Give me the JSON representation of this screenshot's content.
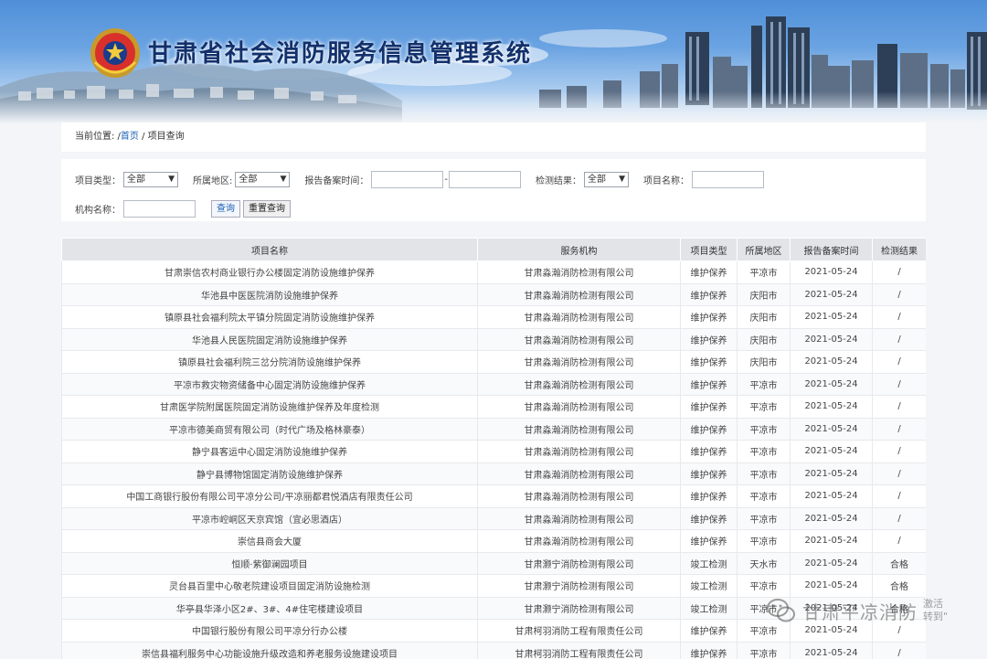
{
  "header": {
    "site_title": "甘肃省社会消防服务信息管理系统"
  },
  "breadcrumb": {
    "prefix": "当前位置: /",
    "home": "首页",
    "separator": " / ",
    "current": "项目查询"
  },
  "filters": {
    "project_type_label": "项目类型：",
    "project_type_value": "全部",
    "region_label": "所属地区:",
    "region_value": "全部",
    "report_time_label": "报告备案时间：",
    "date_separator": "-",
    "result_label": "检测结果：",
    "result_value": "全部",
    "project_name_label": "项目名称：",
    "org_name_label": "机构名称：",
    "search_button": "查询",
    "reset_button": "重置查询"
  },
  "table": {
    "columns": [
      "项目名称",
      "服务机构",
      "项目类型",
      "所属地区",
      "报告备案时间",
      "检测结果"
    ],
    "rows": [
      [
        "甘肃崇信农村商业银行办公楼固定消防设施维护保养",
        "甘肃淼瀚消防检测有限公司",
        "维护保养",
        "平凉市",
        "2021-05-24",
        "/"
      ],
      [
        "华池县中医医院消防设施维护保养",
        "甘肃淼瀚消防检测有限公司",
        "维护保养",
        "庆阳市",
        "2021-05-24",
        "/"
      ],
      [
        "镇原县社会福利院太平镇分院固定消防设施维护保养",
        "甘肃淼瀚消防检测有限公司",
        "维护保养",
        "庆阳市",
        "2021-05-24",
        "/"
      ],
      [
        "华池县人民医院固定消防设施维护保养",
        "甘肃淼瀚消防检测有限公司",
        "维护保养",
        "庆阳市",
        "2021-05-24",
        "/"
      ],
      [
        "镇原县社会福利院三岔分院消防设施维护保养",
        "甘肃淼瀚消防检测有限公司",
        "维护保养",
        "庆阳市",
        "2021-05-24",
        "/"
      ],
      [
        "平凉市救灾物资储备中心固定消防设施维护保养",
        "甘肃淼瀚消防检测有限公司",
        "维护保养",
        "平凉市",
        "2021-05-24",
        "/"
      ],
      [
        "甘肃医学院附属医院固定消防设施维护保养及年度检测",
        "甘肃淼瀚消防检测有限公司",
        "维护保养",
        "平凉市",
        "2021-05-24",
        "/"
      ],
      [
        "平凉市德美商贸有限公司（时代广场及格林豪泰）",
        "甘肃淼瀚消防检测有限公司",
        "维护保养",
        "平凉市",
        "2021-05-24",
        "/"
      ],
      [
        "静宁县客运中心固定消防设施维护保养",
        "甘肃淼瀚消防检测有限公司",
        "维护保养",
        "平凉市",
        "2021-05-24",
        "/"
      ],
      [
        "静宁县博物馆固定消防设施维护保养",
        "甘肃淼瀚消防检测有限公司",
        "维护保养",
        "平凉市",
        "2021-05-24",
        "/"
      ],
      [
        "中国工商银行股份有限公司平凉分公司/平凉丽都君悦酒店有限责任公司",
        "甘肃淼瀚消防检测有限公司",
        "维护保养",
        "平凉市",
        "2021-05-24",
        "/"
      ],
      [
        "平凉市崆峒区天京宾馆（宜必思酒店）",
        "甘肃淼瀚消防检测有限公司",
        "维护保养",
        "平凉市",
        "2021-05-24",
        "/"
      ],
      [
        "崇信县商会大厦",
        "甘肃淼瀚消防检测有限公司",
        "维护保养",
        "平凉市",
        "2021-05-24",
        "/"
      ],
      [
        "恒顺·紫御澜园项目",
        "甘肃灏宁消防检测有限公司",
        "竣工检测",
        "天水市",
        "2021-05-24",
        "合格"
      ],
      [
        "灵台县百里中心敬老院建设项目固定消防设施检测",
        "甘肃灏宁消防检测有限公司",
        "竣工检测",
        "平凉市",
        "2021-05-24",
        "合格"
      ],
      [
        "华亭县华泽小区2#、3#、4#住宅楼建设项目",
        "甘肃灏宁消防检测有限公司",
        "竣工检测",
        "平凉市",
        "2021-05-24",
        "合格"
      ],
      [
        "中国银行股份有限公司平凉分行办公楼",
        "甘肃柯羽消防工程有限责任公司",
        "维护保养",
        "平凉市",
        "2021-05-24",
        "/"
      ],
      [
        "崇信县福利服务中心功能设施升级改造和养老服务设施建设项目",
        "甘肃柯羽消防工程有限责任公司",
        "维护保养",
        "平凉市",
        "2021-05-24",
        "/"
      ]
    ]
  },
  "watermark": {
    "text": "甘肃平凉消防",
    "side_line1": "激活",
    "side_line2": "转到\""
  }
}
